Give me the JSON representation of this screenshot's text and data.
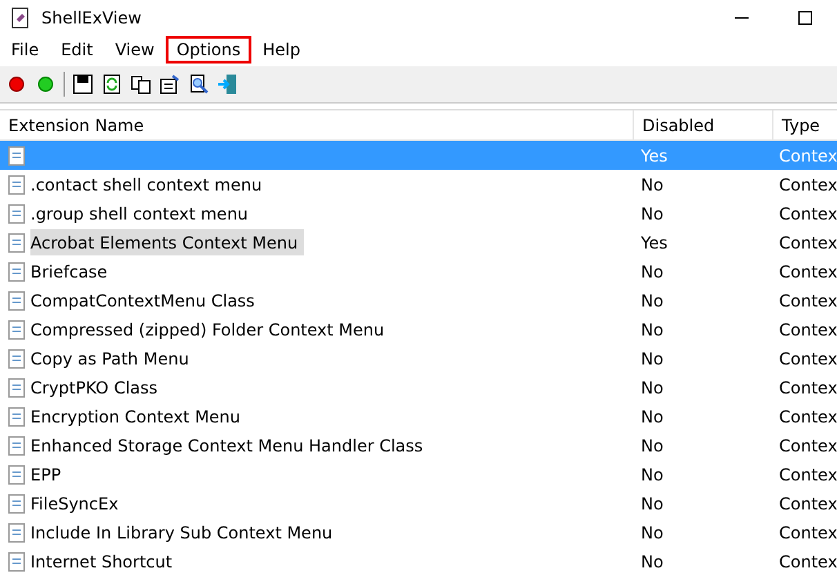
{
  "window": {
    "title": "ShellExView"
  },
  "menu": [
    {
      "label": "File",
      "highlighted": false
    },
    {
      "label": "Edit",
      "highlighted": false
    },
    {
      "label": "View",
      "highlighted": false
    },
    {
      "label": "Options",
      "highlighted": true
    },
    {
      "label": "Help",
      "highlighted": false
    }
  ],
  "table": {
    "columns": [
      "Extension Name",
      "Disabled",
      "Type"
    ],
    "rows": [
      {
        "name": "",
        "disabled": "Yes",
        "type": "Contex",
        "selected": true,
        "hovered": false
      },
      {
        "name": ".contact shell context menu",
        "disabled": "No",
        "type": "Contex",
        "selected": false,
        "hovered": false
      },
      {
        "name": ".group shell context menu",
        "disabled": "No",
        "type": "Contex",
        "selected": false,
        "hovered": false
      },
      {
        "name": "Acrobat Elements Context Menu",
        "disabled": "Yes",
        "type": "Contex",
        "selected": false,
        "hovered": true
      },
      {
        "name": "Briefcase",
        "disabled": "No",
        "type": "Contex",
        "selected": false,
        "hovered": false
      },
      {
        "name": "CompatContextMenu Class",
        "disabled": "No",
        "type": "Contex",
        "selected": false,
        "hovered": false
      },
      {
        "name": "Compressed (zipped) Folder Context Menu",
        "disabled": "No",
        "type": "Contex",
        "selected": false,
        "hovered": false
      },
      {
        "name": "Copy as Path Menu",
        "disabled": "No",
        "type": "Contex",
        "selected": false,
        "hovered": false
      },
      {
        "name": "CryptPKO Class",
        "disabled": "No",
        "type": "Contex",
        "selected": false,
        "hovered": false
      },
      {
        "name": "Encryption Context Menu",
        "disabled": "No",
        "type": "Contex",
        "selected": false,
        "hovered": false
      },
      {
        "name": "Enhanced Storage Context Menu Handler Class",
        "disabled": "No",
        "type": "Contex",
        "selected": false,
        "hovered": false
      },
      {
        "name": "EPP",
        "disabled": "No",
        "type": "Contex",
        "selected": false,
        "hovered": false
      },
      {
        "name": "FileSyncEx",
        "disabled": "No",
        "type": "Contex",
        "selected": false,
        "hovered": false
      },
      {
        "name": "Include In Library Sub Context Menu",
        "disabled": "No",
        "type": "Contex",
        "selected": false,
        "hovered": false
      },
      {
        "name": "Internet Shortcut",
        "disabled": "No",
        "type": "Contex",
        "selected": false,
        "hovered": false
      }
    ]
  }
}
